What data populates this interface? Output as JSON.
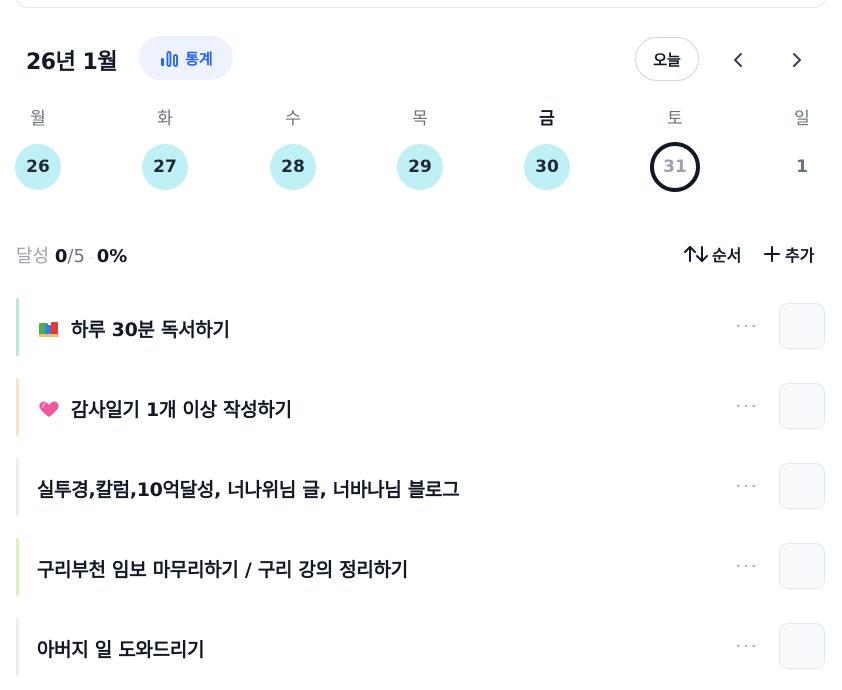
{
  "header": {
    "month_title": "26년 1월",
    "stats_label": "통계",
    "today_label": "오늘"
  },
  "week": {
    "weekdays": [
      "월",
      "화",
      "수",
      "목",
      "금",
      "토",
      "일"
    ],
    "days": [
      "26",
      "27",
      "28",
      "29",
      "30",
      "31",
      "1"
    ],
    "completed_days": [
      "26",
      "27",
      "28",
      "29",
      "30"
    ],
    "selected_day": "31"
  },
  "progress": {
    "label": "달성",
    "done": "0",
    "total": "/5",
    "separator": "·",
    "percent": "0%"
  },
  "actions": {
    "sort_label": "순서",
    "add_label": "추가"
  },
  "tasks": [
    {
      "title": "하루 30분 독서하기",
      "icon": "books-icon",
      "color": "#b7ecd0"
    },
    {
      "title": "감사일기 1개 이상 작성하기",
      "icon": "heart-icon",
      "color": "#fde2c4"
    },
    {
      "title": "실투경,칼럼,10억달성, 너나위님 글, 너바나님 블로그",
      "icon": "",
      "color": "#ededed"
    },
    {
      "title": "구리부천 임보 마무리하기 / 구리 강의 정리하기",
      "icon": "",
      "color": "#d6f5b8"
    },
    {
      "title": "아버지 일 도와드리기",
      "icon": "",
      "color": "#ededed"
    }
  ],
  "colors": {
    "accent": "#2563eb",
    "completed_day": "#bff0f5",
    "text": "#111827",
    "muted": "#9ca3af"
  }
}
